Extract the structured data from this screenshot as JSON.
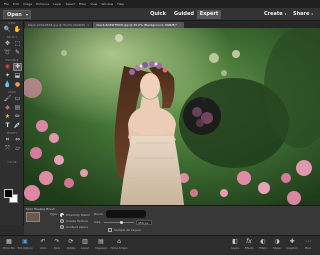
{
  "menubar": [
    "File",
    "Edit",
    "Image",
    "Enhance",
    "Layer",
    "Select",
    "Filter",
    "View",
    "Window",
    "Help"
  ],
  "mode_bar": {
    "open_label": "Open",
    "modes": [
      "Quick",
      "Guided",
      "Expert"
    ],
    "active_mode": "Expert",
    "create_label": "Create",
    "share_label": "Share"
  },
  "toolbox": {
    "groups": [
      "VIEW",
      "SELECT",
      "ENHANCE",
      "DRAW",
      "MODIFY",
      "COLOR"
    ],
    "active_tool": "Spot Healing Brush"
  },
  "doc_tabs": [
    {
      "label": "black-b05e0838.jpg @ 30.0% (RGB/8)",
      "active": false
    },
    {
      "label": "black-6d39f7f0b8.jpg @ 30.0% (Background, RGB/8)*",
      "active": true
    }
  ],
  "options_bar": {
    "tool_name": "Spot Healing Brush",
    "type_label": "Type:",
    "type_options": [
      "Proximity Match",
      "Create Texture",
      "Content Aware"
    ],
    "selected_type": "Proximity Match",
    "brush_label": "Brush:",
    "size_label": "Size:",
    "size_value": "450 px",
    "sample_all_layers_label": "Sample All Layers"
  },
  "taskbar": {
    "left": [
      {
        "icon": "photo-bin-icon",
        "label": "Photo Bin"
      },
      {
        "icon": "tool-options-icon",
        "label": "Tool Options"
      },
      {
        "icon": "undo-icon",
        "label": "Undo"
      },
      {
        "icon": "redo-icon",
        "label": "Redo"
      },
      {
        "icon": "rotate-icon",
        "label": "Rotate"
      },
      {
        "icon": "layout-icon",
        "label": "Layout"
      },
      {
        "icon": "organizer-icon",
        "label": "Organizer"
      },
      {
        "icon": "home-screen-icon",
        "label": "Home Screen"
      }
    ],
    "right": [
      {
        "icon": "layers-icon",
        "label": "Layers"
      },
      {
        "icon": "effects-icon",
        "label": "Effects"
      },
      {
        "icon": "filters-icon",
        "label": "Filters"
      },
      {
        "icon": "styles-icon",
        "label": "Styles"
      },
      {
        "icon": "graphics-icon",
        "label": "Graphics"
      },
      {
        "icon": "more-icon",
        "label": "More"
      }
    ]
  }
}
